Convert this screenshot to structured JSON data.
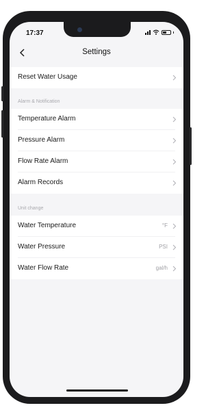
{
  "status": {
    "time": "17:37"
  },
  "nav": {
    "title": "Settings"
  },
  "rows_top": [
    {
      "label": "Reset Water Usage"
    }
  ],
  "sections": {
    "alarm": {
      "header": "Alarm & Notification",
      "items": [
        {
          "label": "Temperature Alarm"
        },
        {
          "label": "Pressure Alarm"
        },
        {
          "label": "Flow Rate Alarm"
        },
        {
          "label": "Alarm Records"
        }
      ]
    },
    "unit": {
      "header": "Unit change",
      "items": [
        {
          "label": "Water Temperature",
          "value": "°F"
        },
        {
          "label": "Water Pressure",
          "value": "PSI"
        },
        {
          "label": "Water Flow Rate",
          "value": "gal/h"
        }
      ]
    }
  },
  "icons": {
    "back": "chevron-left-icon",
    "row": "chevron-right-icon",
    "signal": "signal-icon",
    "wifi": "wifi-icon",
    "battery": "battery-icon"
  }
}
